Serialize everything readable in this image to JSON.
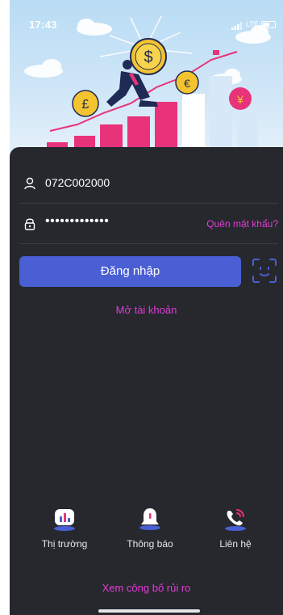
{
  "status_bar": {
    "time": "17:43",
    "network": "LTE"
  },
  "hero": {
    "coins": [
      "$",
      "£",
      "€",
      "¥"
    ]
  },
  "login": {
    "username": "072C002000",
    "password_mask": "•••••••••••••",
    "forgot_label": "Quên mật khẩu?",
    "submit_label": "Đăng nhập",
    "open_account_label": "Mở tài khoản"
  },
  "nav": {
    "items": [
      {
        "label": "Thị trường",
        "icon": "market-chart-icon"
      },
      {
        "label": "Thông báo",
        "icon": "bell-icon"
      },
      {
        "label": "Liên hệ",
        "icon": "phone-contact-icon"
      }
    ]
  },
  "footer": {
    "risk_label": "Xem công bố rủi ro"
  },
  "colors": {
    "panel": "#26282e",
    "accent_button": "#4a5fd4",
    "link": "#e33bd6",
    "face_id": "#4a5fd4"
  }
}
